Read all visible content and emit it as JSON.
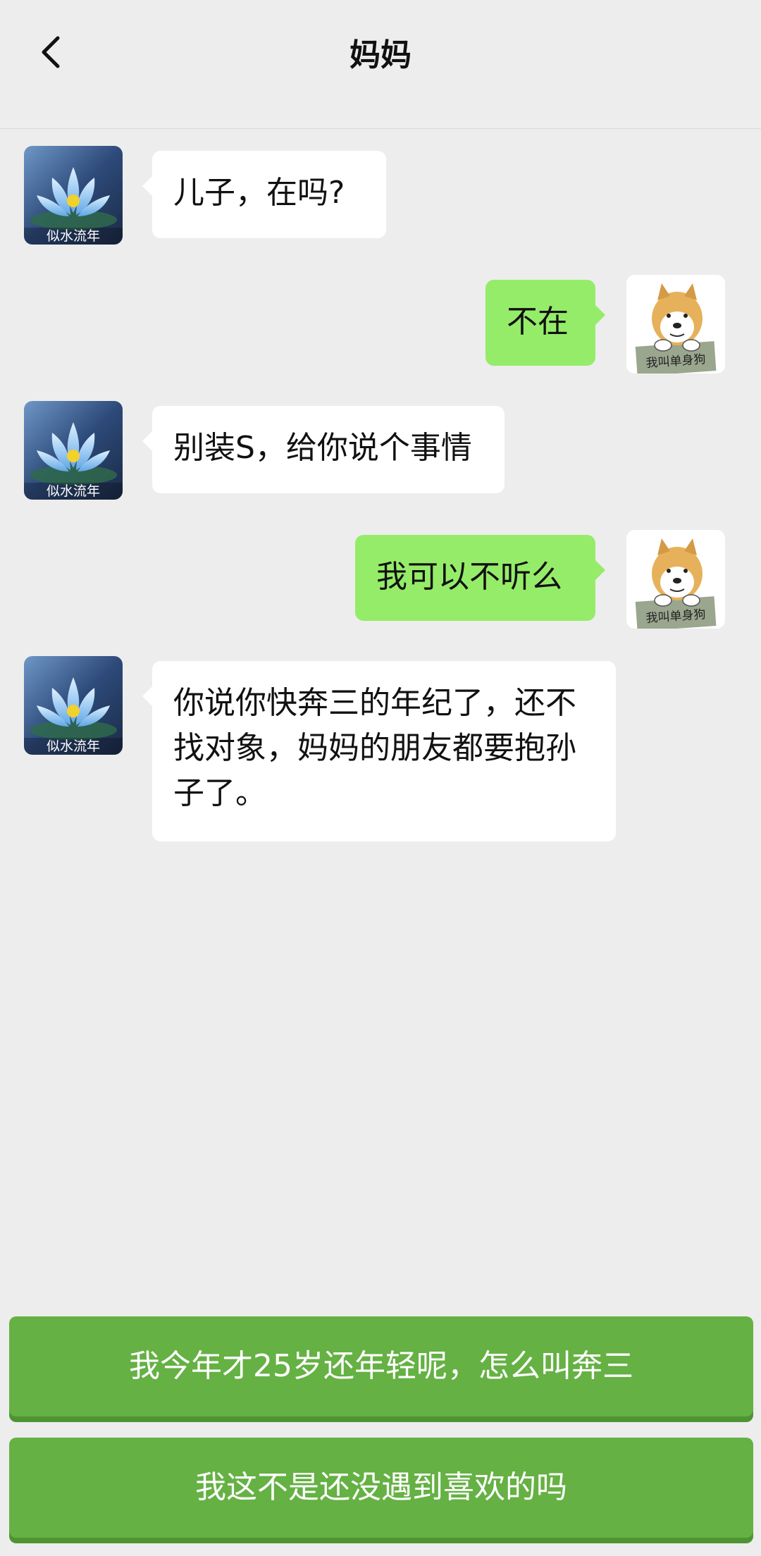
{
  "header": {
    "title": "妈妈"
  },
  "contact": {
    "avatar_caption": "似水流年"
  },
  "me": {
    "avatar_caption": "我叫单身狗"
  },
  "messages": [
    {
      "side": "left",
      "text": "儿子，在吗?"
    },
    {
      "side": "right",
      "text": "不在"
    },
    {
      "side": "left",
      "text": "别装S，给你说个事情"
    },
    {
      "side": "right",
      "text": "我可以不听么"
    },
    {
      "side": "left",
      "text": "你说你快奔三的年纪了，还不找对象，妈妈的朋友都要抱孙子了。"
    }
  ],
  "replies": [
    {
      "label": "我今年才25岁还年轻呢，怎么叫奔三"
    },
    {
      "label": "我这不是还没遇到喜欢的吗"
    }
  ],
  "colors": {
    "background": "#ededed",
    "bubble_self": "#95ec69",
    "bubble_other": "#ffffff",
    "reply_button": "#65b144"
  }
}
